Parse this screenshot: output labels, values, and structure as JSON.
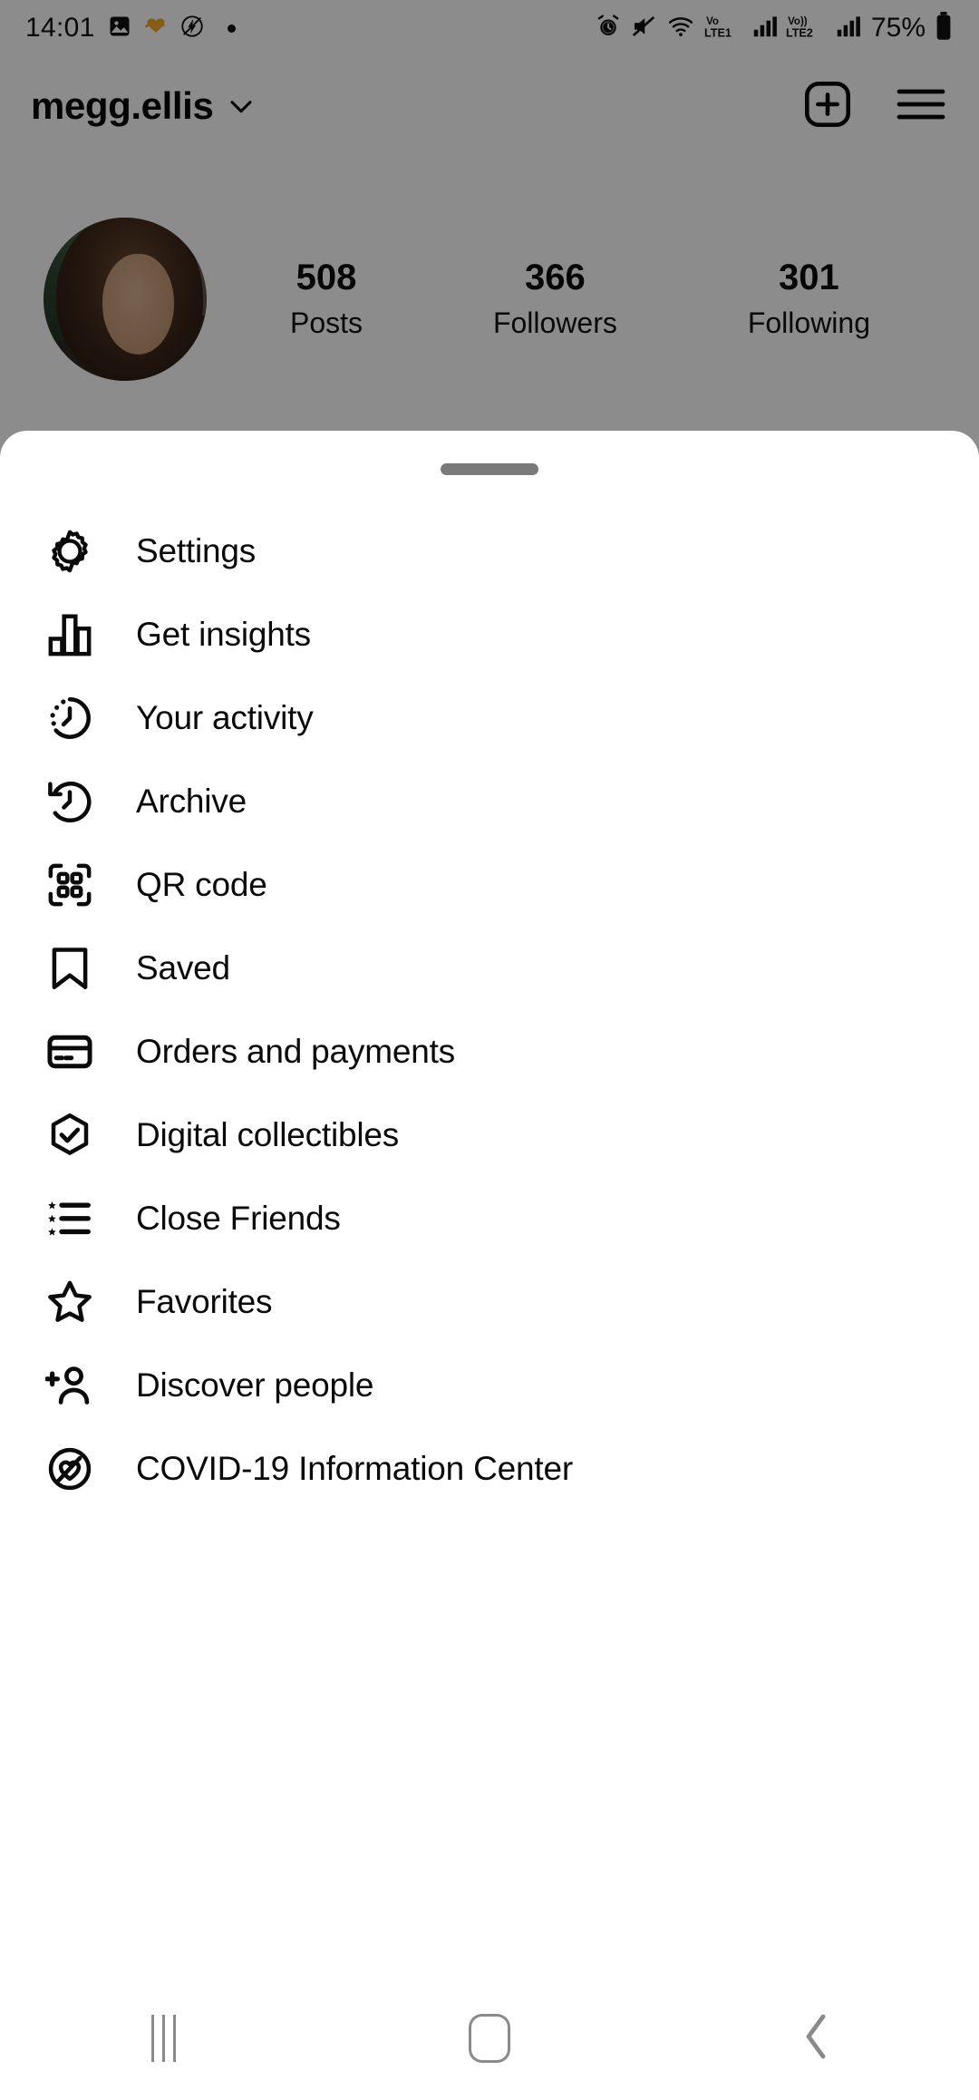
{
  "status_bar": {
    "time": "14:01",
    "battery_percent": "75%",
    "left_icons": [
      "photo-icon",
      "heart-orange-icon",
      "flash-off-icon",
      "dot-indicator"
    ],
    "right_icons": [
      "alarm-icon",
      "mute-icon",
      "wifi-icon",
      "volte1-icon",
      "signal-1-icon",
      "volte2-icon",
      "signal-2-icon",
      "battery-icon"
    ],
    "network_labels": {
      "sim1": "Vo LTE1",
      "sim2": "Vo)) LTE2"
    }
  },
  "header": {
    "username": "megg.ellis",
    "chevron_icon": "chevron-down-icon",
    "add_icon": "plus-box-icon",
    "menu_icon": "hamburger-menu-icon"
  },
  "profile": {
    "avatar_alt": "profile-photo",
    "stats": [
      {
        "value": "508",
        "label": "Posts"
      },
      {
        "value": "366",
        "label": "Followers"
      },
      {
        "value": "301",
        "label": "Following"
      }
    ]
  },
  "sheet": {
    "handle": "drag-handle",
    "items": [
      {
        "label": "Settings",
        "icon": "gear-icon"
      },
      {
        "label": "Get insights",
        "icon": "bar-chart-icon"
      },
      {
        "label": "Your activity",
        "icon": "activity-clock-icon"
      },
      {
        "label": "Archive",
        "icon": "archive-clock-icon"
      },
      {
        "label": "QR code",
        "icon": "qr-code-icon"
      },
      {
        "label": "Saved",
        "icon": "bookmark-icon"
      },
      {
        "label": "Orders and payments",
        "icon": "credit-card-icon"
      },
      {
        "label": "Digital collectibles",
        "icon": "hexagon-check-icon"
      },
      {
        "label": "Close Friends",
        "icon": "star-list-icon"
      },
      {
        "label": "Favorites",
        "icon": "star-outline-icon"
      },
      {
        "label": "Discover people",
        "icon": "person-plus-icon"
      },
      {
        "label": "COVID-19 Information Center",
        "icon": "heart-circle-icon"
      }
    ]
  },
  "navbar": {
    "recents_label": "recents-button",
    "home_label": "home-button",
    "back_label": "back-button"
  },
  "colors": {
    "accent_orange": "#F5A623",
    "text_primary": "#0a0a0a",
    "sheet_bg": "#ffffff",
    "scrim": "rgba(0,0,0,0.45)"
  }
}
